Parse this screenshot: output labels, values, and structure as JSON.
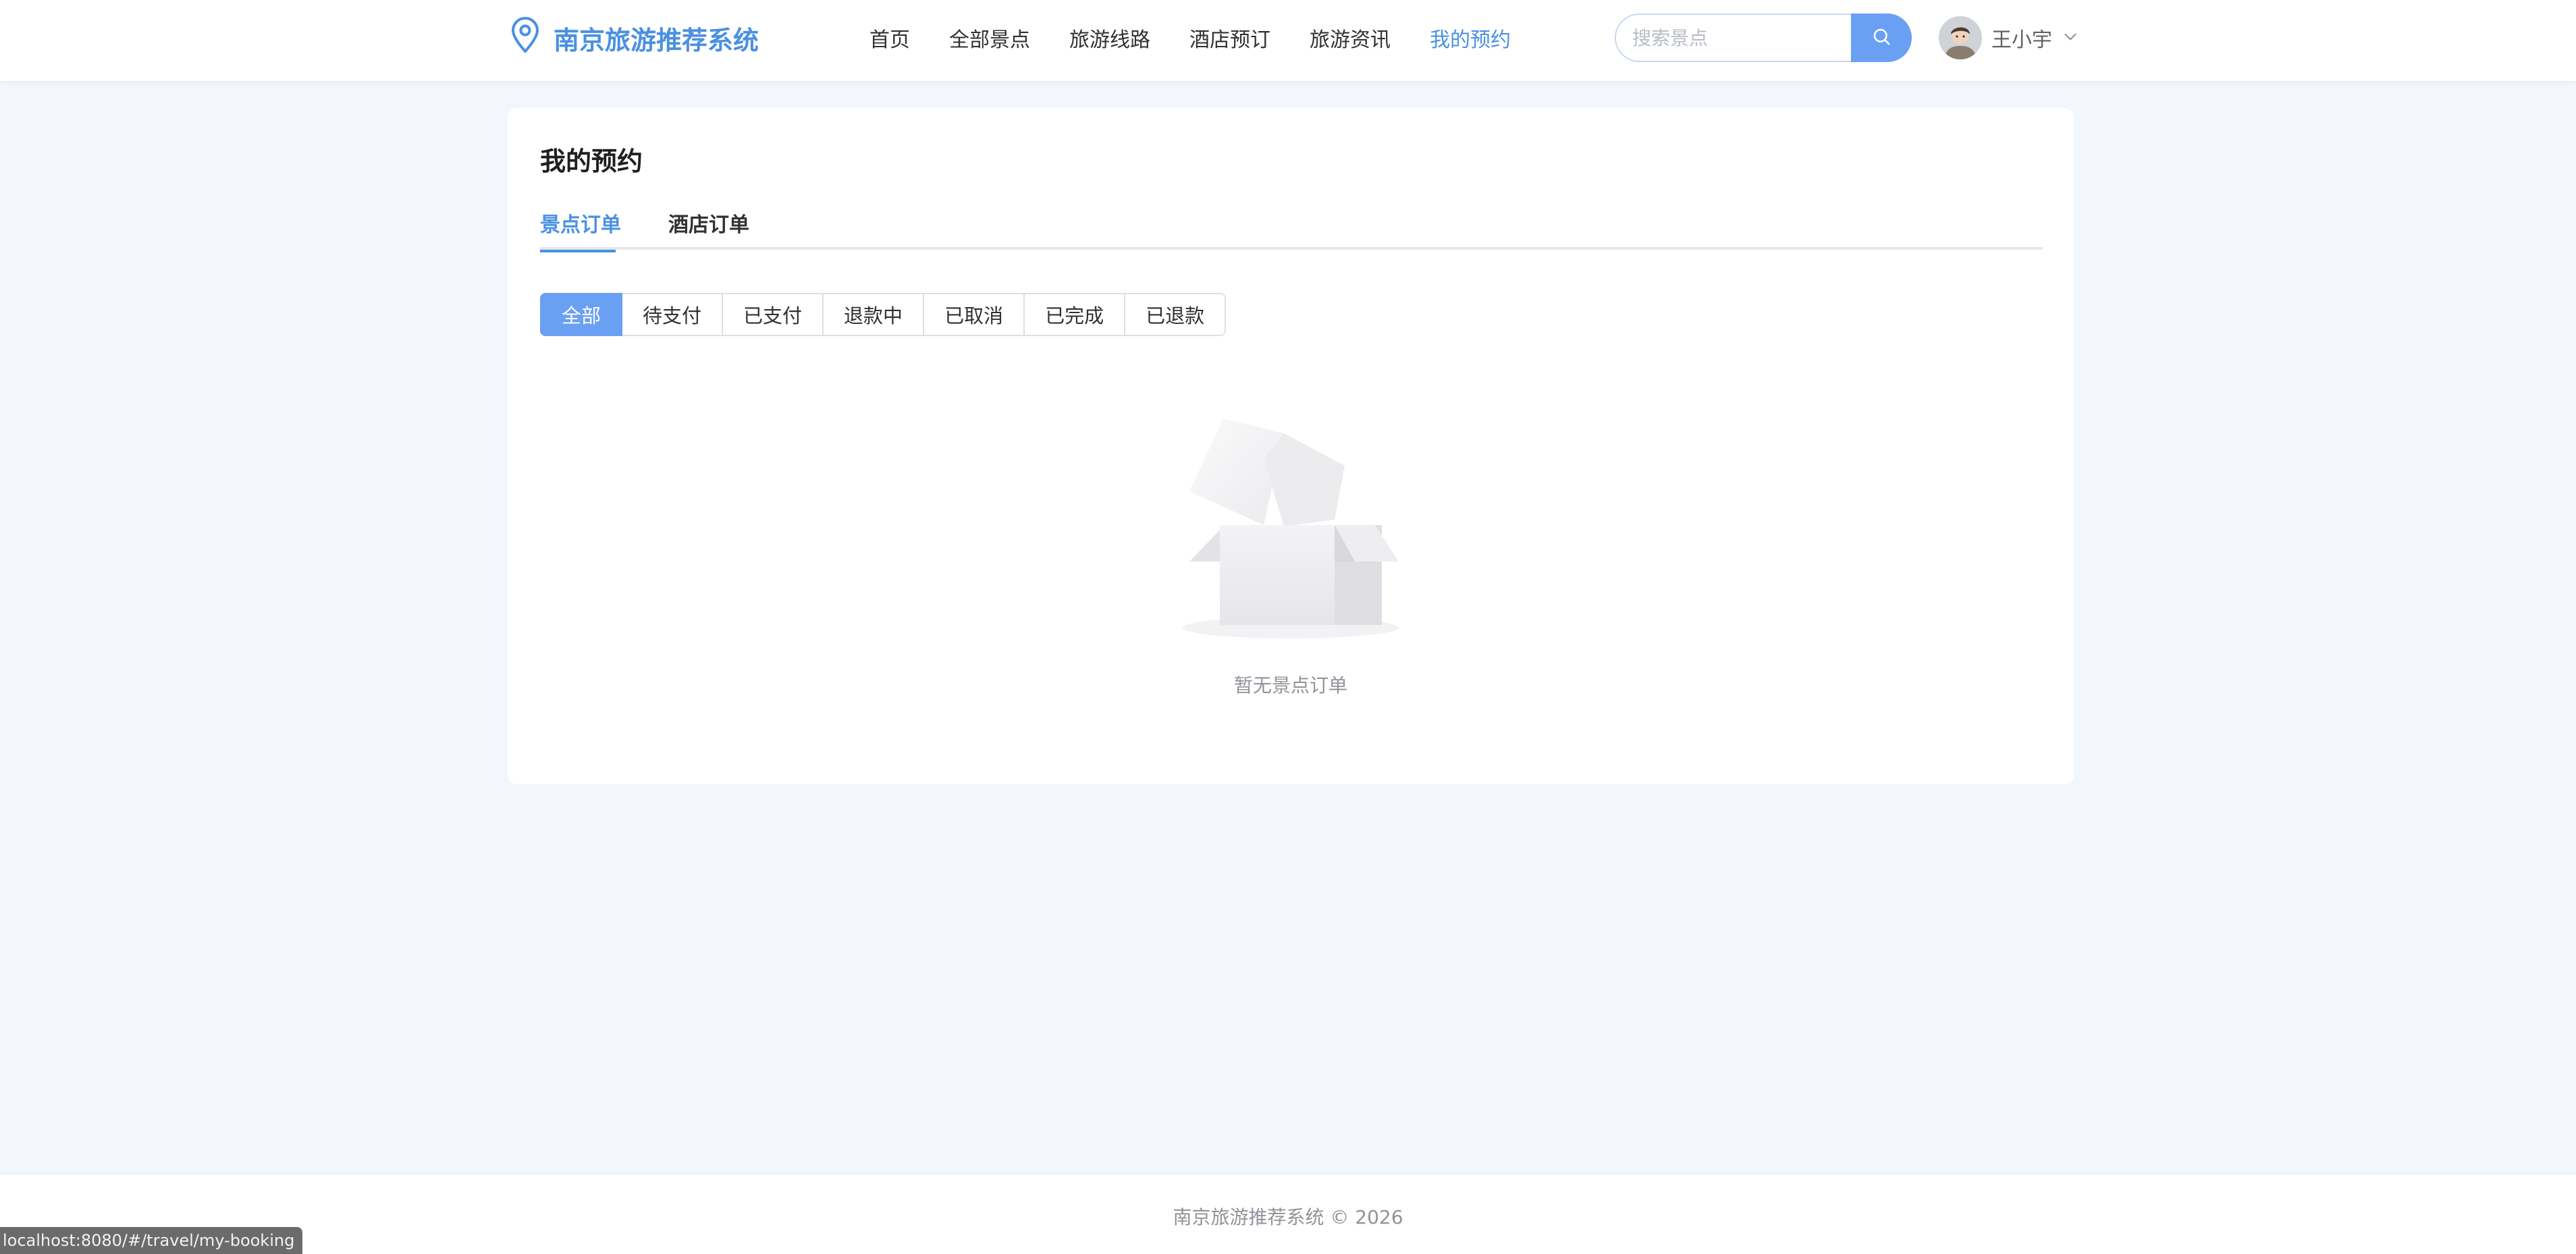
{
  "header": {
    "logo_text": "南京旅游推荐系统",
    "nav": [
      {
        "label": "首页",
        "active": false
      },
      {
        "label": "全部景点",
        "active": false
      },
      {
        "label": "旅游线路",
        "active": false
      },
      {
        "label": "酒店预订",
        "active": false
      },
      {
        "label": "旅游资讯",
        "active": false
      },
      {
        "label": "我的预约",
        "active": true
      }
    ],
    "search": {
      "placeholder": "搜索景点",
      "value": ""
    },
    "user": {
      "name": "王小宇"
    }
  },
  "main": {
    "title": "我的预约",
    "tabs": [
      {
        "label": "景点订单",
        "active": true
      },
      {
        "label": "酒店订单",
        "active": false
      }
    ],
    "filters": [
      {
        "label": "全部",
        "active": true
      },
      {
        "label": "待支付",
        "active": false
      },
      {
        "label": "已支付",
        "active": false
      },
      {
        "label": "退款中",
        "active": false
      },
      {
        "label": "已取消",
        "active": false
      },
      {
        "label": "已完成",
        "active": false
      },
      {
        "label": "已退款",
        "active": false
      }
    ],
    "empty_text": "暂无景点订单"
  },
  "footer": {
    "text": "南京旅游推荐系统 © 2026"
  },
  "status_bar": {
    "url": "localhost:8080/#/travel/my-booking"
  },
  "colors": {
    "primary": "#4a90e2",
    "button": "#6aa0f3",
    "background": "#f3f7fd"
  },
  "icons": {
    "logo": "location-pin-icon",
    "search": "search-icon",
    "dropdown": "chevron-down-icon",
    "empty": "empty-box-icon"
  }
}
